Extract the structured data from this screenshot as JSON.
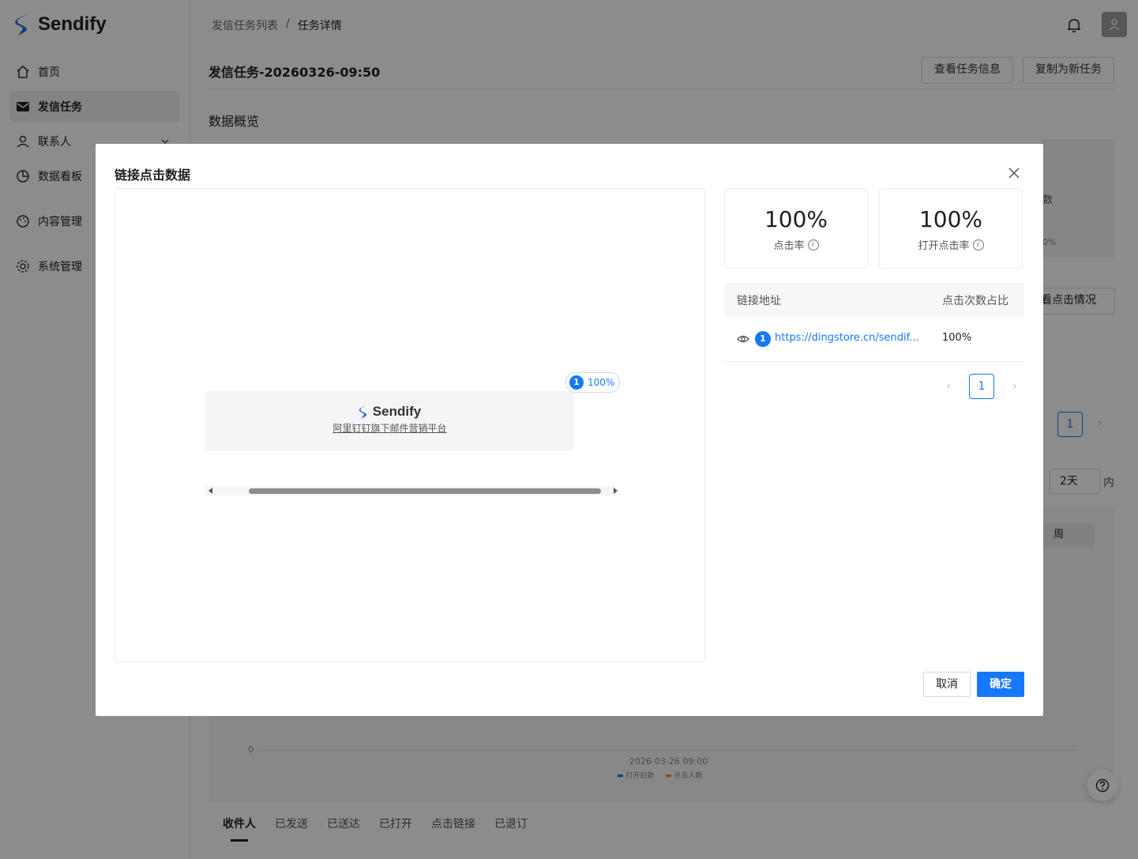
{
  "app": {
    "name": "Sendify",
    "brand_color": "#1677ff"
  },
  "sidebar": {
    "items": [
      {
        "label": "首页",
        "icon": "home-icon"
      },
      {
        "label": "发信任务",
        "icon": "mail-icon",
        "active": true
      },
      {
        "label": "联系人",
        "icon": "user-icon"
      },
      {
        "label": "数据看板",
        "icon": "pie-chart-icon"
      },
      {
        "label": "内容管理",
        "icon": "palette-icon"
      },
      {
        "label": "系统管理",
        "icon": "gear-icon"
      }
    ]
  },
  "breadcrumb": {
    "parent": "发信任务列表",
    "separator": "/",
    "current": "任务详情"
  },
  "header": {
    "task_title": "发信任务-20260326-09:50",
    "view_info_button": "查看任务信息",
    "copy_button": "复制为新任务",
    "overview_title": "数据概览"
  },
  "background": {
    "partial_text_a": "数",
    "partial_text_b": "0%",
    "view_clicks_button": "看点击情况",
    "page_number": "1",
    "select_value": "2天",
    "select_suffix": "内",
    "week_label": "周",
    "chart_y_zero": "0",
    "chart_x_label": "2026-03-26 09:00",
    "legend_open": "打开封数",
    "legend_click": "点击人数",
    "tabs": [
      "收件人",
      "已发送",
      "已送达",
      "已打开",
      "点击链接",
      "已退订"
    ]
  },
  "modal": {
    "title": "链接点击数据",
    "preview": {
      "logo_text": "Sendify",
      "link_text": "阿里钉钉旗下邮件营销平台",
      "badge_num": "1",
      "badge_pct": "100%"
    },
    "stats": [
      {
        "value": "100%",
        "label": "点击率"
      },
      {
        "value": "100%",
        "label": "打开点击率"
      }
    ],
    "table": {
      "headers": [
        "链接地址",
        "点击次数占比"
      ],
      "rows": [
        {
          "num": "1",
          "url": "https://dingstore.cn/sendif...",
          "pct": "100%"
        }
      ]
    },
    "pagination": {
      "current": "1"
    },
    "cancel_button": "取消",
    "ok_button": "确定"
  }
}
